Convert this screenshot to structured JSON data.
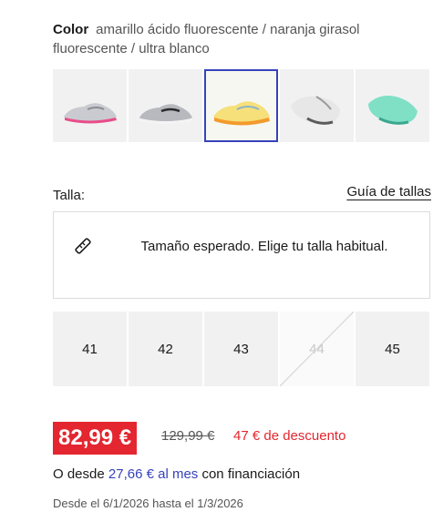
{
  "color": {
    "label": "Color",
    "value": "amarillo ácido fluorescente / naranja girasol fluorescente / ultra blanco"
  },
  "thumbnails": [
    {
      "name": "shoe-grey-pink",
      "accent": "#e84d8a",
      "selected": false
    },
    {
      "name": "shoe-grey-white",
      "accent": "#9aa0a6",
      "selected": false
    },
    {
      "name": "shoe-yellow-orange",
      "accent": "#f2c230",
      "selected": true
    },
    {
      "name": "shoe-white-grey",
      "accent": "#bdbdbd",
      "selected": false
    },
    {
      "name": "shoe-mint",
      "accent": "#67d3b9",
      "selected": false
    }
  ],
  "size_section": {
    "label": "Talla:",
    "guide_link": "Guía de tallas",
    "info_icon": "ruler-icon",
    "info_text": "Tamaño esperado. Elige tu talla habitual.",
    "sizes": [
      {
        "label": "41",
        "available": true
      },
      {
        "label": "42",
        "available": true
      },
      {
        "label": "43",
        "available": true
      },
      {
        "label": "44",
        "available": false
      },
      {
        "label": "45",
        "available": true
      }
    ]
  },
  "price": {
    "current": "82,99 €",
    "old": "129,99 €",
    "discount": "47 € de descuento",
    "finance_prefix": "O desde",
    "finance_link": "27,66 € al mes",
    "finance_suffix": "con financiación",
    "dates": "Desde el 6/1/2026 hasta el 1/3/2026"
  },
  "colors": {
    "accent": "#3643ba",
    "sale": "#e3262f",
    "tile": "#f1f1f2"
  }
}
